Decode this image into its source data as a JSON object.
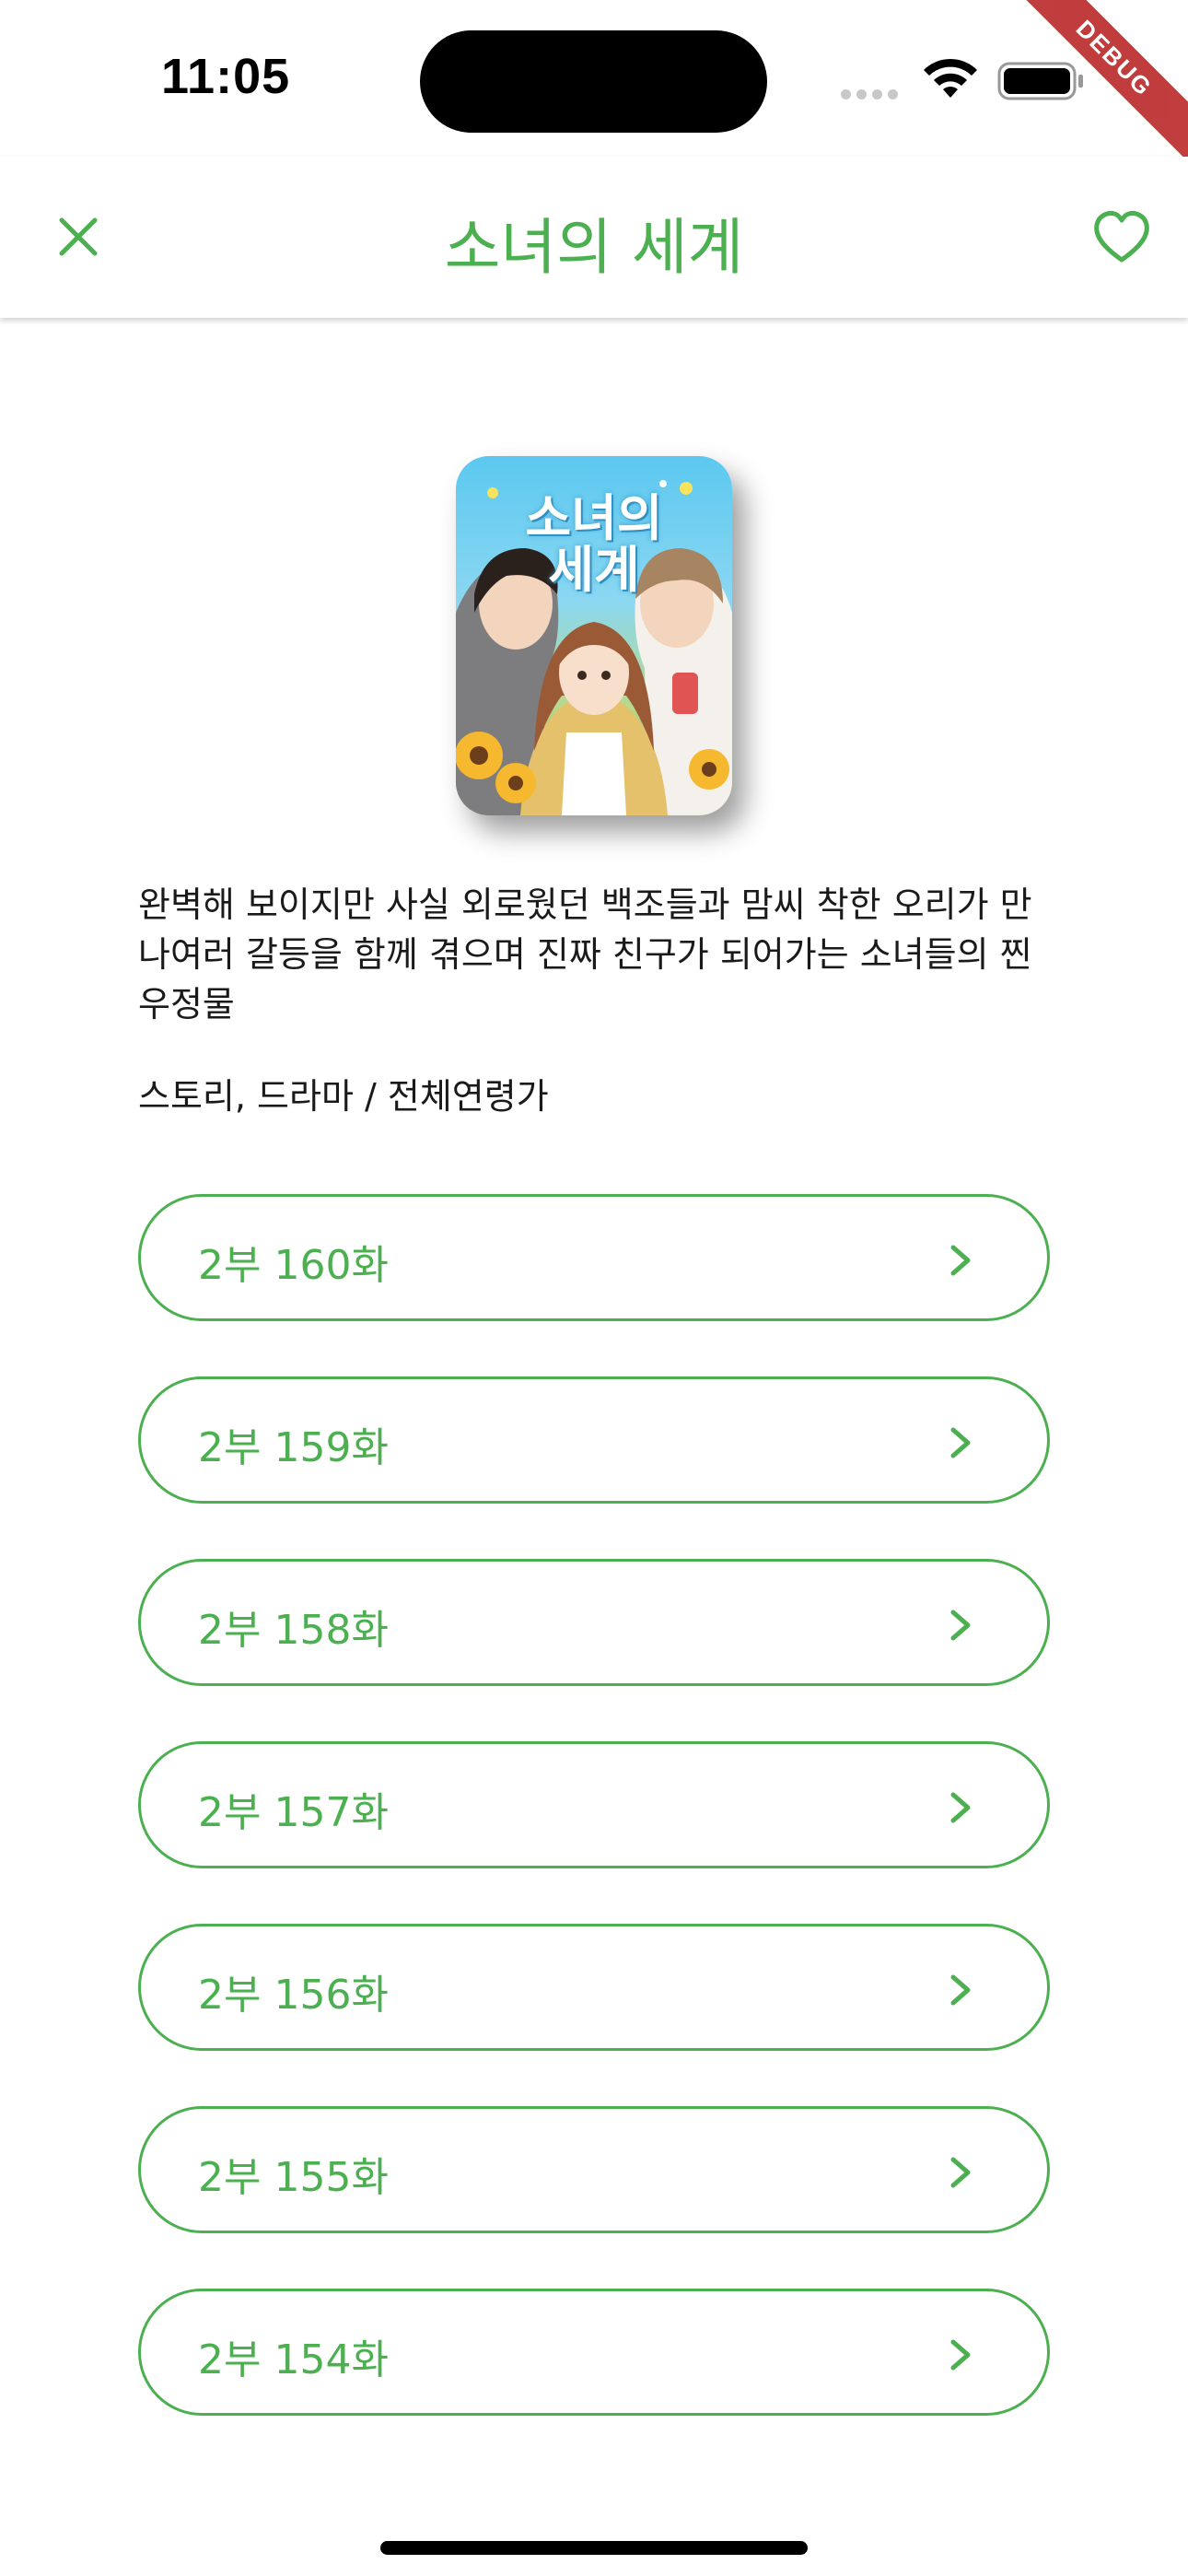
{
  "status_bar": {
    "time": "11:05"
  },
  "debug_banner": "DEBUG",
  "app_bar": {
    "title": "소녀의 세계",
    "close_icon": "close-icon",
    "favorite_icon": "heart-outline-icon"
  },
  "cover": {
    "title_line1": "소녀의",
    "title_line2": "세계"
  },
  "description": "완벽해 보이지만 사실 외로웠던 백조들과 맘씨 착한 오리가 만나여러 갈등을 함께 겪으며 진짜 친구가 되어가는 소녀들의 찐 우정물",
  "genre_age": "스토리, 드라마 / 전체연령가",
  "episodes": [
    {
      "label": "2부 160화"
    },
    {
      "label": "2부 159화"
    },
    {
      "label": "2부 158화"
    },
    {
      "label": "2부 157화"
    },
    {
      "label": "2부 156화"
    },
    {
      "label": "2부 155화"
    },
    {
      "label": "2부 154화"
    }
  ],
  "colors": {
    "accent": "#4caf50",
    "text": "#1a1a1a",
    "background": "#ffffff"
  }
}
